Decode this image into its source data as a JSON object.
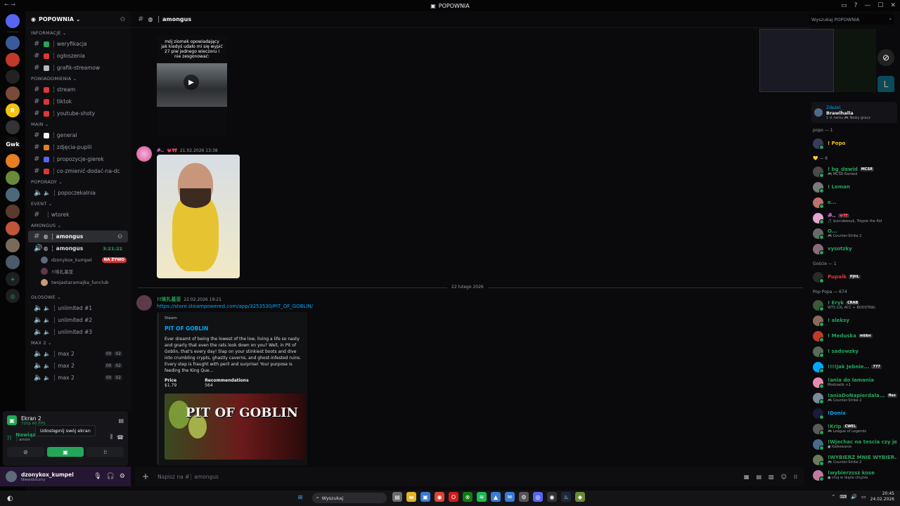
{
  "window": {
    "title": "POPOWNIA"
  },
  "server": {
    "name": "POPOWNIA ⌄"
  },
  "guilds": [
    {
      "label": "",
      "color": "#5865f2",
      "icon": "discord-icon"
    },
    {
      "label": "",
      "color": "#3a5a9a"
    },
    {
      "label": "",
      "color": "#c0392b"
    },
    {
      "label": "",
      "color": "#222"
    },
    {
      "label": "",
      "color": "#7a4b3a"
    },
    {
      "label": "R",
      "color": "#f1c40f"
    },
    {
      "label": "",
      "color": "#333"
    },
    {
      "label": "Gwk",
      "color": "#111"
    },
    {
      "label": "",
      "color": "#e67e22"
    },
    {
      "label": "",
      "color": "#6a8a3a"
    },
    {
      "label": "",
      "color": "#4a6a7a"
    },
    {
      "label": "",
      "color": "#5a3a2a"
    },
    {
      "label": "",
      "color": "#c0553a"
    },
    {
      "label": "",
      "color": "#7a6a5a"
    },
    {
      "label": "",
      "color": "#4a5a6a"
    }
  ],
  "categories": {
    "informacje": "INFORMACJE ⌄",
    "powiadomienia": "POWIADOMIENIA ⌄",
    "main": "MAIN ⌄",
    "poporady": "POPORADY ⌄",
    "event": "EVENT ⌄",
    "amongus": "amongus ⌄",
    "glosowe": "GŁOSOWE ⌄",
    "max2": "MAX 2 ⌄"
  },
  "channels": {
    "informacje": [
      {
        "name": "┊ weryfikacja",
        "emoji": "#23a55a"
      },
      {
        "name": "┊ ogłoszenia",
        "emoji": "#da373c"
      },
      {
        "name": "┊ grafik-streamow",
        "emoji": "#b5bac1"
      }
    ],
    "powiadomienia": [
      {
        "name": "┊ stream",
        "emoji": "#da373c"
      },
      {
        "name": "┊ tiktok",
        "emoji": "#da373c"
      },
      {
        "name": "┊ youtube-shoty",
        "emoji": "#da373c"
      }
    ],
    "main": [
      {
        "name": "┊ general",
        "emoji": "#f2f3f5"
      },
      {
        "name": "┊ zdjęcia-pupili",
        "emoji": "#e67e22"
      },
      {
        "name": "┊ propozycje-gierek",
        "emoji": "#5865f2"
      },
      {
        "name": "┊ co-zmienić-dodać-na-dc",
        "emoji": "#da373c"
      }
    ],
    "poporady": [
      {
        "name": "┊ popoczekalnia"
      }
    ],
    "event": [
      {
        "name": "┊ wtorek"
      }
    ],
    "amongus_text": "┊ amongus",
    "amongus_voice": "┊ amongus",
    "amongus_time": "3:21:22",
    "voice_users": [
      {
        "name": "dzonykox_kumpel",
        "live": "NA ŻYWO",
        "color": "#5d6b7a"
      },
      {
        "name": "!!埃扎基亚",
        "color": "#5d3a4a"
      },
      {
        "name": "twojastaramajka_funclub",
        "color": "#c89a7a"
      }
    ],
    "glosowe": [
      {
        "name": "┊ unlimited #1"
      },
      {
        "name": "┊ unlimited #2"
      },
      {
        "name": "┊ unlimited #3"
      }
    ],
    "max2": [
      {
        "name": "┊ max 2",
        "a": "00",
        "b": "02"
      },
      {
        "name": "┊ max 2",
        "a": "00",
        "b": "02"
      },
      {
        "name": "┊ max 2",
        "a": "00",
        "b": "02"
      }
    ]
  },
  "panel": {
    "screen_name": "Ekran 2",
    "screen_sub": "720p 60 FPS",
    "voice_status": "Nawiąz",
    "voice_channel": "┊ amon",
    "tooltip": "Udostępnij swój ekran"
  },
  "user": {
    "name": "dzonykox_kumpel",
    "status": "Niewidoczny"
  },
  "chat": {
    "channel": "┊ amongus",
    "video_caption": "mój ziomek opowiadający jak kiedyś udało mi się wypić 27 piw jednego wieczoru i nie zesgonować:",
    "msg2_user": "ॐ..",
    "msg2_badge": "💗🎀",
    "msg2_time": "21.02.2026 13:38",
    "date_separator": "22 lutego 2026",
    "msg3_user": "!!埃扎基亚",
    "msg3_time": "22.02.2026 19:21",
    "link": "https://store.steampowered.com/app/3253530/PIT_OF_GOBLIN/",
    "embed": {
      "provider": "Steam",
      "title": "PIT OF GOBLIN",
      "description": "Ever dreamt of being the lowest of the low, living a life so nasty and gnarly that even the rats look down on you? Well, in Pit of Goblin, that's every day! Slap on your stinkiest boots and dive into crumbling crypts, ghastly caverns, and ghost-infested ruins. Every step is fraught with peril and surprise! Your purpose is feeding the King Que...",
      "price_label": "Price",
      "price": "$1.79",
      "rec_label": "Recommendations",
      "rec": "564",
      "banner_text": "PIT OF GOBLIN"
    },
    "placeholder": "Napisz na #┊ amongus"
  },
  "search": {
    "placeholder": "Wyszukaj POPOWNIA"
  },
  "members": {
    "activity": {
      "game": "Zdezel_",
      "title": "Brawlhalla",
      "sub": "1 d. temu  🎮 Nowy gracz"
    },
    "groups": [
      {
        "label": "popo — 1",
        "items": [
          {
            "name": "! Popo",
            "color": "#f1c40f",
            "av": "#3a3a5a"
          }
        ]
      },
      {
        "label": "💛 — 6",
        "items": [
          {
            "name": "! bg_dawid",
            "tag": "MCSR",
            "sub": "🎮 MCSR Ranked",
            "color": "#23a55a",
            "av": "#4a4a4a"
          },
          {
            "name": "! Leman",
            "color": "#23a55a",
            "av": "#7a7a7a"
          },
          {
            "name": "e...",
            "color": "#23a55a",
            "av": "#c07070"
          },
          {
            "name": "ॐ..",
            "tag": "💗🎀",
            "sub": "🎵 $uicideboy$, Trippie the Kid",
            "color": "#f47fff",
            "av": "#e5a5d0"
          },
          {
            "name": "O...",
            "sub": "🎮 Counter-Strike 2",
            "color": "#23a55a",
            "av": "#6a6a6a"
          },
          {
            "name": "vysotzky",
            "color": "#23a55a",
            "av": "#8a6a7a"
          }
        ]
      },
      {
        "label": "Goście — 1",
        "items": [
          {
            "name": "Pupaik",
            "tag": "PJHL",
            "color": "#da373c",
            "av": "#2a2a2a"
          }
        ]
      },
      {
        "label": "Pop Popa — 674",
        "items": [
          {
            "name": "! Eryk",
            "tag": "CRAB",
            "sub": "WTS LOL ACC + BOOSTING",
            "color": "#23a55a",
            "av": "#3a5a3a"
          },
          {
            "name": "! aleksy",
            "color": "#23a55a",
            "av": "#8a6a5a"
          },
          {
            "name": "! Meduska",
            "tag": "mbbn",
            "color": "#23a55a",
            "av": "#c0392b"
          },
          {
            "name": "! sadowzky",
            "color": "#23a55a",
            "av": "#5a6a5a"
          },
          {
            "name": "!!!!jak Jebnie...",
            "tag": "777",
            "color": "#23a55a",
            "av": "#00a8fc"
          },
          {
            "name": "!ania do lamania",
            "sub": "Modrzelik +1",
            "color": "#23a55a",
            "av": "#e58ab0"
          },
          {
            "name": "!aniaDoNapierdala...",
            "tag": "flex",
            "sub": "🎮 Counter-Strike 2",
            "color": "#23a55a",
            "av": "#7a8a9a"
          },
          {
            "name": "!Donix",
            "color": "#00a8fc",
            "av": "#1a1a3a"
          },
          {
            "name": "!Krip",
            "tag": "CWEL",
            "sub": "🎮 League of Legends",
            "color": "#23a55a",
            "av": "#5a5a5a"
          },
          {
            "name": "!Wjechac na tescia czy je...",
            "sub": "● Kalkowanie",
            "color": "#23a55a",
            "av": "#4a6a8a"
          },
          {
            "name": "!WYBIERZ MNIE WYBIER...",
            "sub": "🎮 Counter-Strike 2",
            "color": "#23a55a",
            "av": "#6a7a5a"
          },
          {
            "name": "!wybierzssz kose",
            "sub": "● chuj w dupie chujnie",
            "color": "#23a55a",
            "av": "#c07aa0"
          }
        ]
      }
    ]
  },
  "taskbar": {
    "search": "Wyszukaj",
    "time": "20:45",
    "date": "24.02.2026"
  }
}
